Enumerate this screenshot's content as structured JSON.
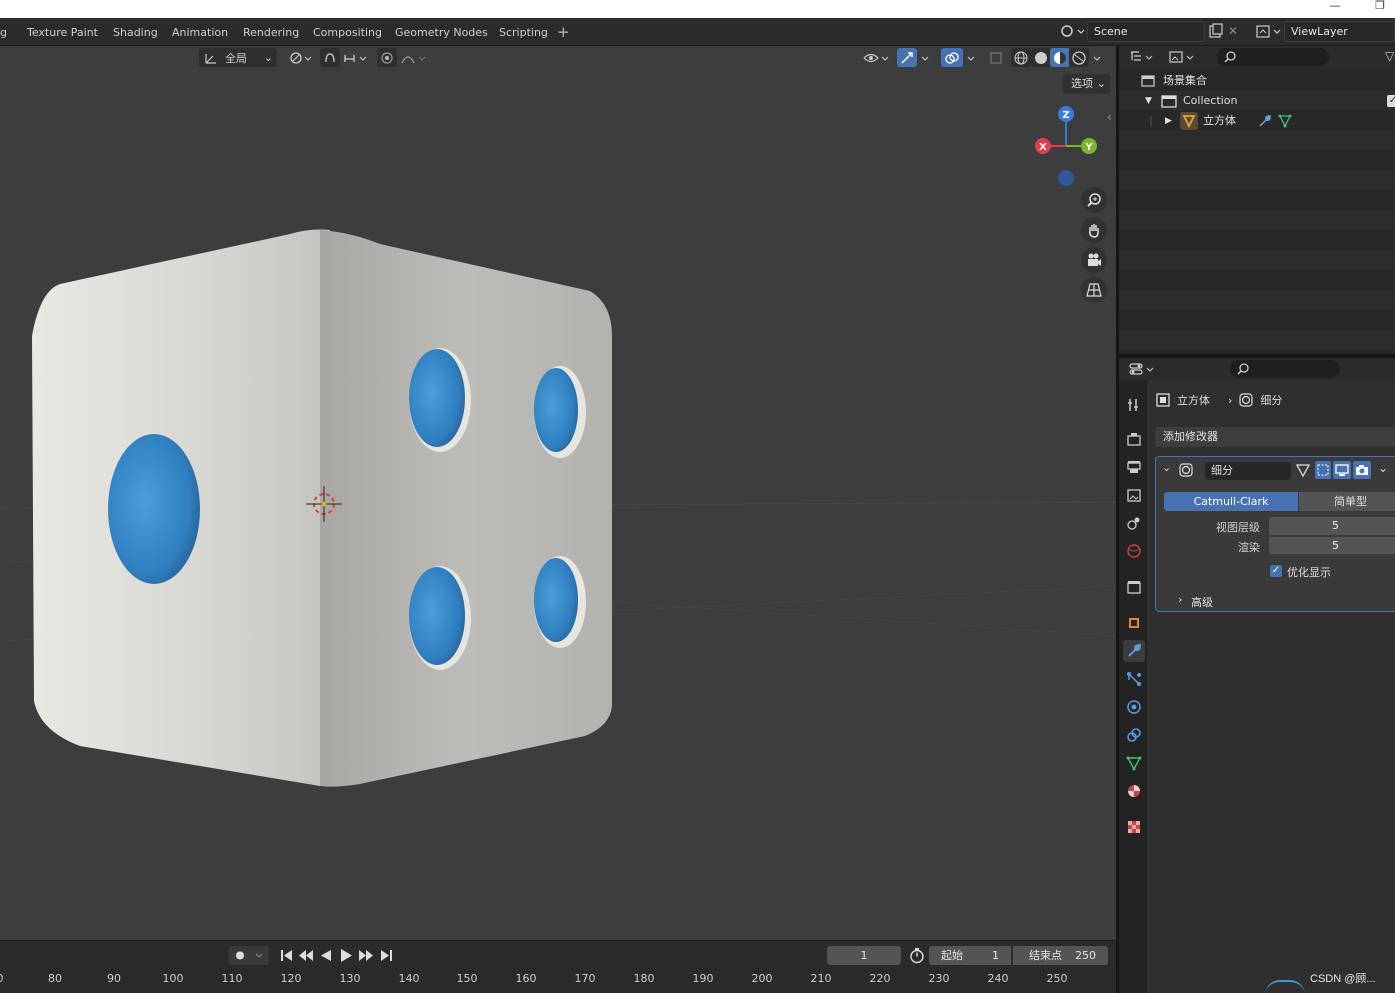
{
  "workspace_tabs": [
    "g",
    "Texture Paint",
    "Shading",
    "Animation",
    "Rendering",
    "Compositing",
    "Geometry Nodes",
    "Scripting"
  ],
  "scene": {
    "name": "Scene",
    "view_layer": "ViewLayer"
  },
  "viewport": {
    "orientation": "全局",
    "options_label": "选项",
    "gizmo": {
      "z": "Z",
      "x": "X",
      "y": "Y"
    }
  },
  "outliner": {
    "scene_collection": "场景集合",
    "collection": "Collection",
    "object": "立方体"
  },
  "properties": {
    "breadcrumb_object": "立方体",
    "breadcrumb_modifier": "细分",
    "add_modifier": "添加修改器",
    "modifier": {
      "name": "细分",
      "type_catmull": "Catmull-Clark",
      "type_simple": "简单型",
      "viewport_label": "视图层级",
      "viewport_value": "5",
      "render_label": "渲染",
      "render_value": "5",
      "optimal_label": "优化显示",
      "optimal_checked": true,
      "advanced_label": "高级"
    }
  },
  "timeline": {
    "current_frame": "1",
    "start_label": "起始",
    "start_value": "1",
    "end_label": "结束点",
    "end_value": "250",
    "ruler": [
      "0",
      "80",
      "90",
      "100",
      "110",
      "120",
      "130",
      "140",
      "150",
      "160",
      "170",
      "180",
      "190",
      "200",
      "210",
      "220",
      "230",
      "240",
      "250"
    ]
  },
  "watermark": "CSDN @顾..."
}
